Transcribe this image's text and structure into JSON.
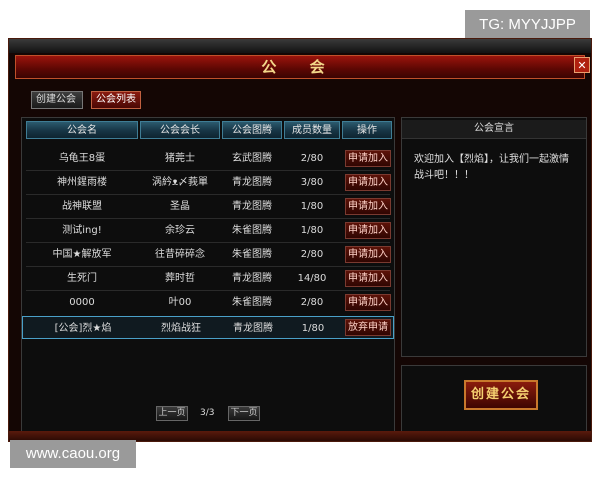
{
  "watermarks": {
    "top": "TG: MYYJJPP",
    "bottom": "www.caou.org"
  },
  "window": {
    "title": "公 会",
    "close_label": "✕"
  },
  "tabs": [
    {
      "label": "创建公会",
      "active": false
    },
    {
      "label": "公会列表",
      "active": true
    }
  ],
  "table": {
    "headers": [
      "公会名",
      "公会会长",
      "公会图腾",
      "成员数量",
      "操作"
    ],
    "rows": [
      {
        "name": "乌龟王8蛋",
        "leader": "猪莞士",
        "totem": "玄武图腾",
        "members": "2/80",
        "action": "申请加入"
      },
      {
        "name": "神州鍟雨楼",
        "leader": "涡紟ᴥ〆莪單",
        "totem": "青龙图腾",
        "members": "3/80",
        "action": "申请加入"
      },
      {
        "name": "战神联盟",
        "leader": "圣晶",
        "totem": "青龙图腾",
        "members": "1/80",
        "action": "申请加入"
      },
      {
        "name": "测试ing!",
        "leader": "余珍云",
        "totem": "朱雀图腾",
        "members": "1/80",
        "action": "申请加入"
      },
      {
        "name": "中国★解放军",
        "leader": "往昔碎碎念",
        "totem": "朱雀图腾",
        "members": "2/80",
        "action": "申请加入"
      },
      {
        "name": "生死门",
        "leader": "葬时哲",
        "totem": "青龙图腾",
        "members": "14/80",
        "action": "申请加入"
      },
      {
        "name": "0000",
        "leader": "叶00",
        "totem": "朱雀图腾",
        "members": "2/80",
        "action": "申请加入"
      },
      {
        "name": "[公会]烈★焰",
        "leader": "烈焰战狂",
        "totem": "青龙图腾",
        "members": "1/80",
        "action": "放弃申请"
      }
    ]
  },
  "pager": {
    "prev": "上一页",
    "page": "3/3",
    "next": "下一页"
  },
  "declaration": {
    "heading": "公会宣言",
    "text": "欢迎加入【烈焰】，让我们一起激情战斗吧！！！"
  },
  "create_button_label": "创建公会"
}
